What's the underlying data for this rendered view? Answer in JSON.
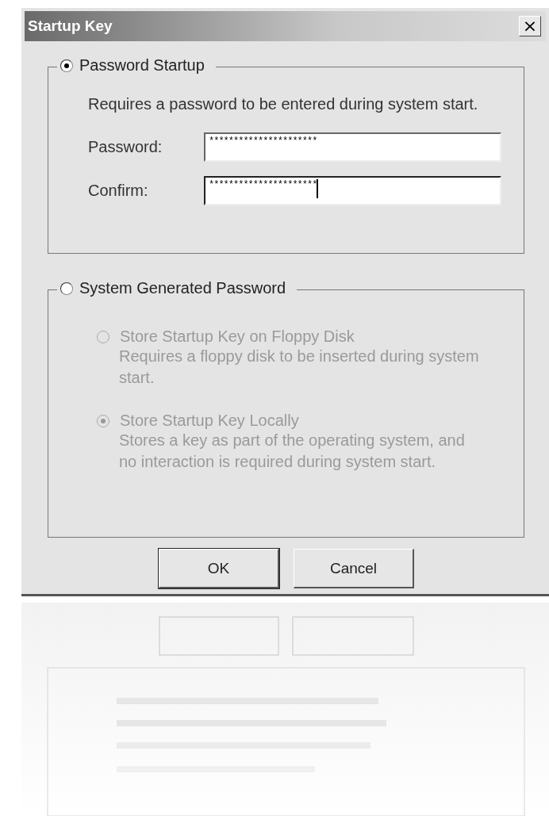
{
  "window": {
    "title": "Startup Key",
    "close": "×"
  },
  "groups": [
    {
      "label": "Password Startup",
      "selected": true,
      "description": "Requires a password to be entered during system start.",
      "fields": [
        {
          "label": "Password:",
          "value": "**********************",
          "focused": false
        },
        {
          "label": "Confirm:",
          "value": "**********************",
          "focused": true
        }
      ]
    },
    {
      "label": "System Generated Password",
      "selected": false,
      "options": [
        {
          "label": "Store Startup Key on Floppy Disk",
          "selected": false,
          "disabled": true,
          "description": "Requires a floppy disk to be inserted during system start."
        },
        {
          "label": "Store Startup Key Locally",
          "selected": true,
          "disabled": true,
          "description": "Stores a key as part of the operating system, and no interaction is required during system start."
        }
      ]
    }
  ],
  "buttons": [
    {
      "label": "OK",
      "default": true
    },
    {
      "label": "Cancel",
      "default": false
    }
  ]
}
